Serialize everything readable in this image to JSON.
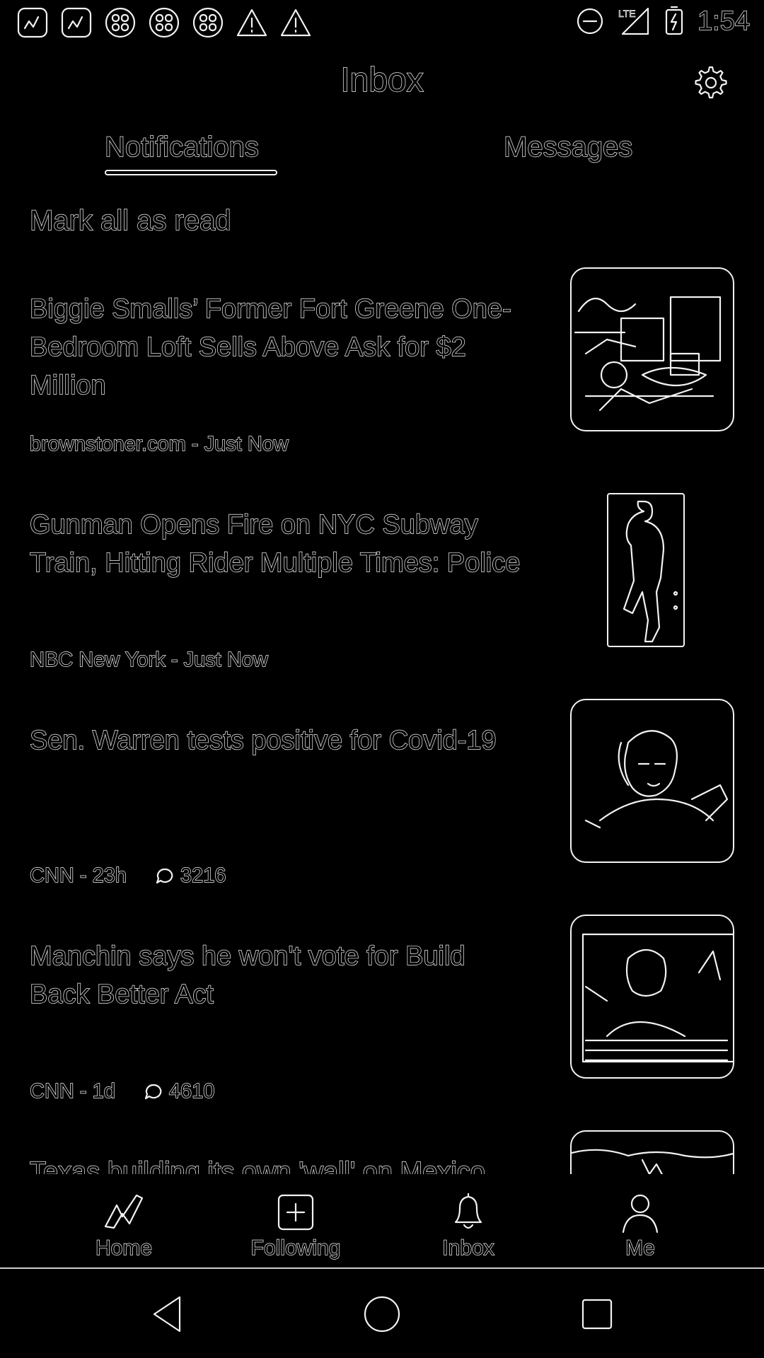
{
  "status_bar": {
    "left_icons": [
      "app-icon",
      "app-icon",
      "grid-icon",
      "grid-icon",
      "grid-icon",
      "warning-icon",
      "warning-icon"
    ],
    "right_icons": [
      "do-not-disturb-icon",
      "lte-signal-icon",
      "battery-charging-icon"
    ],
    "network": "LTE",
    "time": "1:54"
  },
  "header": {
    "title": "Inbox",
    "settings_icon": "gear-icon"
  },
  "tabs": [
    {
      "label": "Notifications",
      "active": true
    },
    {
      "label": "Messages",
      "active": false
    }
  ],
  "mark_all_label": "Mark all as read",
  "notifications": [
    {
      "title": "Biggie Smalls’ Former Fort Greene One-Bedroom Loft Sells Above Ask for $2 Million",
      "meta": "brownstoner.com - Just Now",
      "comments": null,
      "thumb": "interior-photo"
    },
    {
      "title": "Gunman Opens Fire on NYC Subway Train, Hitting Rider Multiple Times: Police",
      "meta": "NBC New York - Just Now",
      "comments": null,
      "thumb": "person-walking-photo"
    },
    {
      "title": "Sen. Warren tests positive for Covid-19",
      "meta": "CNN - 23h",
      "comments": "3216",
      "thumb": "portrait-photo"
    },
    {
      "title": "Manchin says he won't vote for Build Back Better Act",
      "meta": "CNN - 1d",
      "comments": "4610",
      "thumb": "news-broadcast-photo"
    },
    {
      "title": "Texas building its own 'wall' on Mexico",
      "meta": "",
      "comments": null,
      "thumb": "landscape-photo"
    }
  ],
  "bottom_nav": [
    {
      "label": "Home",
      "icon": "home-logo-icon"
    },
    {
      "label": "Following",
      "icon": "plus-square-icon"
    },
    {
      "label": "Inbox",
      "icon": "bell-icon"
    },
    {
      "label": "Me",
      "icon": "person-icon"
    }
  ],
  "system_nav": [
    "back-icon",
    "home-circle-icon",
    "recents-square-icon"
  ]
}
